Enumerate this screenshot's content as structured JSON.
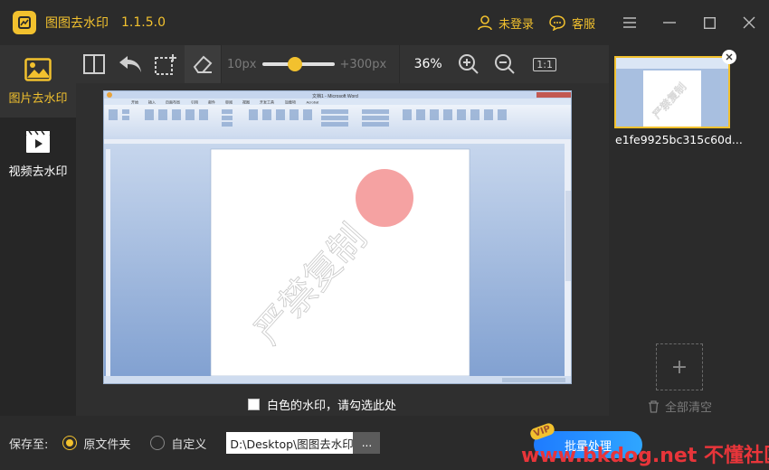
{
  "app": {
    "name": "图图去水印",
    "version": "1.1.5.0",
    "login_label": "未登录",
    "service_label": "客服",
    "accent_color": "#f2c12e"
  },
  "sidebar": {
    "items": [
      {
        "label": "图片去水印",
        "icon": "image-icon",
        "active": true
      },
      {
        "label": "视频去水印",
        "icon": "video-icon",
        "active": false
      }
    ]
  },
  "toolbar": {
    "brush_min": "10px",
    "brush_max": "+300px",
    "brush_level_fraction": 0.45,
    "zoom": "36%",
    "fit_label": "1:1"
  },
  "canvas": {
    "white_watermark_label": "白色的水印，请勾选此处",
    "image_watermark_text": "严禁复制",
    "word_title": "文档1 - Microsoft Word",
    "word_tabs": [
      "开始",
      "插入",
      "页面布局",
      "引用",
      "邮件",
      "审阅",
      "视图",
      "开发工具",
      "加载项",
      "Acrobat"
    ]
  },
  "files": {
    "items": [
      {
        "name": "e1fe9925bc315c60d..."
      }
    ],
    "add_label": "+",
    "clear_all_label": "全部清空"
  },
  "bottom": {
    "save_to_label": "保存至:",
    "option_original": "原文件夹",
    "option_custom": "自定义",
    "path_value": "D:\\Desktop\\图图去水印",
    "browse_label": "...",
    "batch_label": "批量处理",
    "vip_label": "VIP",
    "site_watermark": "www.bkdog.net 不懂社区"
  }
}
